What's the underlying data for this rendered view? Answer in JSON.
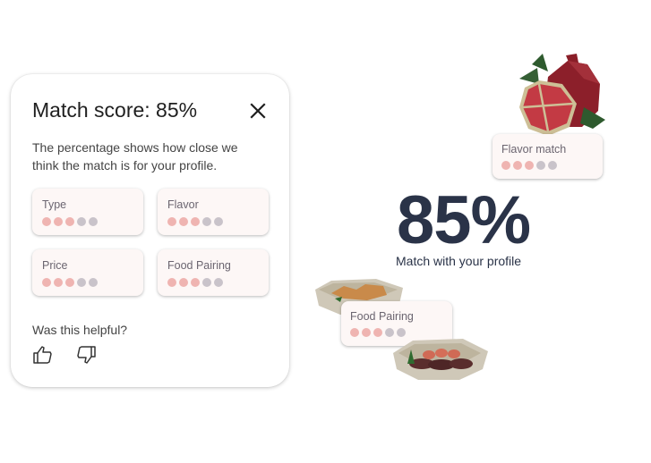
{
  "dialog": {
    "title": "Match score: 85%",
    "description": "The percentage shows how close we think the match is for your profile.",
    "close_icon": "close-icon",
    "criteria": [
      {
        "label": "Type",
        "score": 3,
        "max": 5
      },
      {
        "label": "Flavor",
        "score": 3,
        "max": 5
      },
      {
        "label": "Price",
        "score": 3,
        "max": 5
      },
      {
        "label": "Food Pairing",
        "score": 3,
        "max": 5
      }
    ],
    "helpful_prompt": "Was this helpful?",
    "thumbs_up_icon": "thumbs-up-icon",
    "thumbs_down_icon": "thumbs-down-icon"
  },
  "illustration": {
    "percentage": "85%",
    "subtitle": "Match with your profile",
    "flavor_card": {
      "label": "Flavor match",
      "score": 3,
      "max": 5
    },
    "pairing_card": {
      "label": "Food Pairing",
      "score": 3,
      "max": 5
    }
  },
  "colors": {
    "dot_active": "#efb4b1",
    "dot_inactive": "#c9c3ca",
    "headline": "#2a3348"
  }
}
